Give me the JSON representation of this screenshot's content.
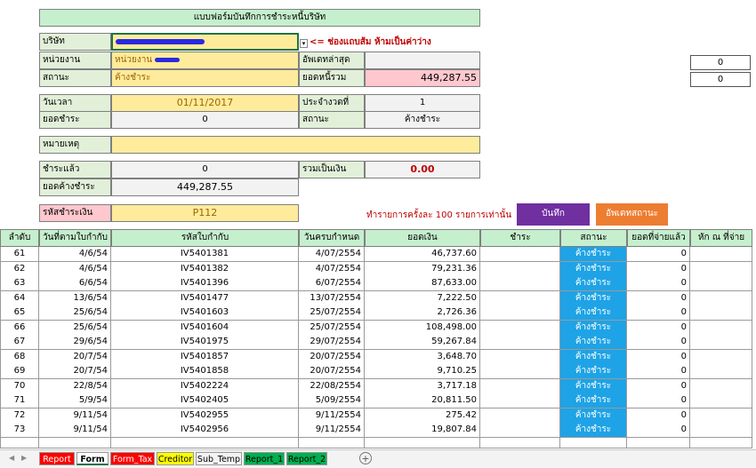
{
  "form": {
    "title": "แบบฟอร์มบันทึกการชำระหนี้บริษัท",
    "company_label": "บริษัท",
    "dept_label": "หน่วยงาน",
    "dept_value": "หน่วยงาน",
    "update_label": "อัพเดทล่าสุด",
    "status_label": "สถานะ",
    "status_value": "ค้างชำระ",
    "total_label": "ยอดหนี้รวม",
    "total_value": "449,287.55",
    "hint": "<= ช่องแถบส้ม ห้ามเป็นค่าว่าง",
    "date_label": "วันเวลา",
    "date_value": "01/11/2017",
    "period_label": "ประจำงวดที่",
    "period_value": "1",
    "paid_amt_label": "ยอดชำระ",
    "paid_amt_value": "0",
    "status2_label": "สถานะ",
    "status2_value": "ค้างชำระ",
    "note_label": "หมายเหตุ",
    "paid_label": "ชำระแล้ว",
    "paid_value": "0",
    "sum_label": "รวมเป็นเงิน",
    "sum_value": "0.00",
    "owed_label": "ยอดค้างชำระ",
    "owed_value": "449,287.55",
    "code_label": "รหัสชำระเงิน",
    "code_value": "P112",
    "limit_note": "ทำรายการครั้งละ 100 รายการเท่านั้น",
    "save_btn": "บันทึก",
    "update_btn": "อัพเดทสถานะ"
  },
  "side_values": [
    "0",
    "0"
  ],
  "colors": {
    "save": "#7030a0",
    "update": "#ed7d31",
    "status": "#1ea3e6",
    "header": "#c6efce"
  },
  "table": {
    "headers": [
      "ลำดับ",
      "วันที่ตามใบกำกับ",
      "รหัสใบกำกับ",
      "วันครบกำหนด",
      "ยอดเงิน",
      "ชำระ",
      "สถานะ",
      "ยอดที่จ่ายแล้ว",
      "หัก ณ ที่จ่าย"
    ],
    "rows": [
      {
        "no": "61",
        "date": "4/6/54",
        "code": "IV5401381",
        "due": "4/07/2554",
        "amount": "46,737.60",
        "status": "ค้างชำระ",
        "paid": "0"
      },
      {
        "no": "62",
        "date": "4/6/54",
        "code": "IV5401382",
        "due": "4/07/2554",
        "amount": "79,231.36",
        "status": "ค้างชำระ",
        "paid": "0"
      },
      {
        "no": "63",
        "date": "6/6/54",
        "code": "IV5401396",
        "due": "6/07/2554",
        "amount": "87,633.00",
        "status": "ค้างชำระ",
        "paid": "0"
      },
      {
        "no": "64",
        "date": "13/6/54",
        "code": "IV5401477",
        "due": "13/07/2554",
        "amount": "7,222.50",
        "status": "ค้างชำระ",
        "paid": "0"
      },
      {
        "no": "65",
        "date": "25/6/54",
        "code": "IV5401603",
        "due": "25/07/2554",
        "amount": "2,726.36",
        "status": "ค้างชำระ",
        "paid": "0"
      },
      {
        "no": "66",
        "date": "25/6/54",
        "code": "IV5401604",
        "due": "25/07/2554",
        "amount": "108,498.00",
        "status": "ค้างชำระ",
        "paid": "0"
      },
      {
        "no": "67",
        "date": "29/6/54",
        "code": "IV5401975",
        "due": "29/07/2554",
        "amount": "59,267.84",
        "status": "ค้างชำระ",
        "paid": "0"
      },
      {
        "no": "68",
        "date": "20/7/54",
        "code": "IV5401857",
        "due": "20/07/2554",
        "amount": "3,648.70",
        "status": "ค้างชำระ",
        "paid": "0"
      },
      {
        "no": "69",
        "date": "20/7/54",
        "code": "IV5401858",
        "due": "20/07/2554",
        "amount": "9,710.25",
        "status": "ค้างชำระ",
        "paid": "0"
      },
      {
        "no": "70",
        "date": "22/8/54",
        "code": "IV5402224",
        "due": "22/08/2554",
        "amount": "3,717.18",
        "status": "ค้างชำระ",
        "paid": "0"
      },
      {
        "no": "71",
        "date": "5/9/54",
        "code": "IV5402405",
        "due": "5/09/2554",
        "amount": "20,811.50",
        "status": "ค้างชำระ",
        "paid": "0"
      },
      {
        "no": "72",
        "date": "9/11/54",
        "code": "IV5402955",
        "due": "9/11/2554",
        "amount": "275.42",
        "status": "ค้างชำระ",
        "paid": "0"
      },
      {
        "no": "73",
        "date": "9/11/54",
        "code": "IV5402956",
        "due": "9/11/2554",
        "amount": "19,807.84",
        "status": "ค้างชำระ",
        "paid": "0"
      }
    ]
  },
  "tabs": [
    {
      "label": "Report",
      "bg": "#ff0000",
      "fg": "#ffffff"
    },
    {
      "label": "Form",
      "bg": "#ffffff",
      "fg": "#000000"
    },
    {
      "label": "Form_Tax",
      "bg": "#ff0000",
      "fg": "#ffffff"
    },
    {
      "label": "Creditor",
      "bg": "#ffff00",
      "fg": "#000000"
    },
    {
      "label": "Sub_Temp",
      "bg": "#f3f3f3",
      "fg": "#000000"
    },
    {
      "label": "Report_1",
      "bg": "#00b050",
      "fg": "#000000"
    },
    {
      "label": "Report_2",
      "bg": "#00b050",
      "fg": "#000000"
    }
  ],
  "add_sheet": "+"
}
